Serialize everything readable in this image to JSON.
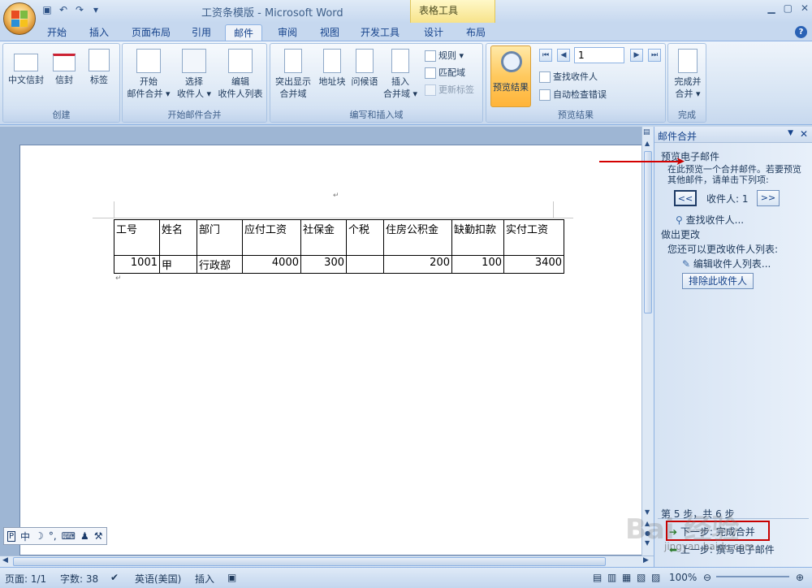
{
  "window": {
    "title": "工资条模版 - Microsoft Word",
    "context_tab_group": "表格工具",
    "controls": [
      "▁",
      "▢",
      "✕"
    ]
  },
  "qat": {
    "save_icon": "save-icon",
    "undo_icon": "undo-icon",
    "redo_icon": "redo-icon"
  },
  "tabs": [
    "开始",
    "插入",
    "页面布局",
    "引用",
    "邮件",
    "审阅",
    "视图",
    "开发工具",
    "设计",
    "布局"
  ],
  "ribbon": {
    "groups": {
      "create": "创建",
      "start_merge": "开始邮件合并",
      "write_insert": "编写和插入域",
      "preview": "预览结果",
      "finish": "完成"
    },
    "create_buttons": [
      "中文信封",
      "信封",
      "标签"
    ],
    "start_merge_buttons": [
      {
        "line1": "开始",
        "line2": "邮件合并 ▾"
      },
      {
        "line1": "选择",
        "line2": "收件人 ▾"
      },
      {
        "line1": "编辑",
        "line2": "收件人列表"
      }
    ],
    "write_buttons": [
      {
        "line1": "突出显示",
        "line2": "合并域"
      },
      {
        "line1": "地址块",
        "line2": ""
      },
      {
        "line1": "问候语",
        "line2": ""
      },
      {
        "line1": "插入",
        "line2": "合并域 ▾"
      }
    ],
    "write_small": [
      "规则 ▾",
      "匹配域",
      "更新标签"
    ],
    "preview_button": "预览结果",
    "record_value": "1",
    "preview_small": [
      "查找收件人",
      "自动检查错误"
    ],
    "finish_button": {
      "line1": "完成并",
      "line2": "合并 ▾"
    }
  },
  "document": {
    "headers": [
      "工号",
      "姓名",
      "部门",
      "应付工资",
      "社保金",
      "个税",
      "住房公积金",
      "缺勤扣款",
      "实付工资"
    ],
    "row": [
      "1001",
      "甲",
      "行政部",
      "4000",
      "300",
      "",
      "200",
      "100",
      "3400"
    ],
    "para_mark": "↵"
  },
  "taskpane": {
    "title": "邮件合并",
    "section1_title": "预览电子邮件",
    "section1_desc": "在此预览一个合并邮件。若要预览其他邮件，请单击下列项:",
    "prev_button": "<<",
    "next_button": ">>",
    "recipient_label": "收件人:",
    "recipient_value": "1",
    "find_recipient": "查找收件人...",
    "section2_title": "做出更改",
    "section2_desc": "您还可以更改收件人列表:",
    "edit_list": "编辑收件人列表...",
    "exclude_button": "排除此收件人",
    "step_text": "第 5 步，共 6 步",
    "next_step": "下一步: 完成合并",
    "prev_step": "上一步: 撰写电子邮件"
  },
  "statusbar": {
    "page": "页面: 1/1",
    "words": "字数: 38",
    "language": "英语(美国)",
    "mode": "插入",
    "zoom": "100%"
  },
  "ime": [
    "中",
    "☽",
    "°,",
    "⌨",
    "♟",
    "⚒"
  ],
  "watermark": {
    "main": "Bai 经验",
    "url": "jingyan.baidu.com"
  },
  "colors": {
    "accent": "#15428b",
    "ribbon": "#dbe7f5",
    "highlight": "#ffc95e",
    "annotation": "#c80000"
  }
}
